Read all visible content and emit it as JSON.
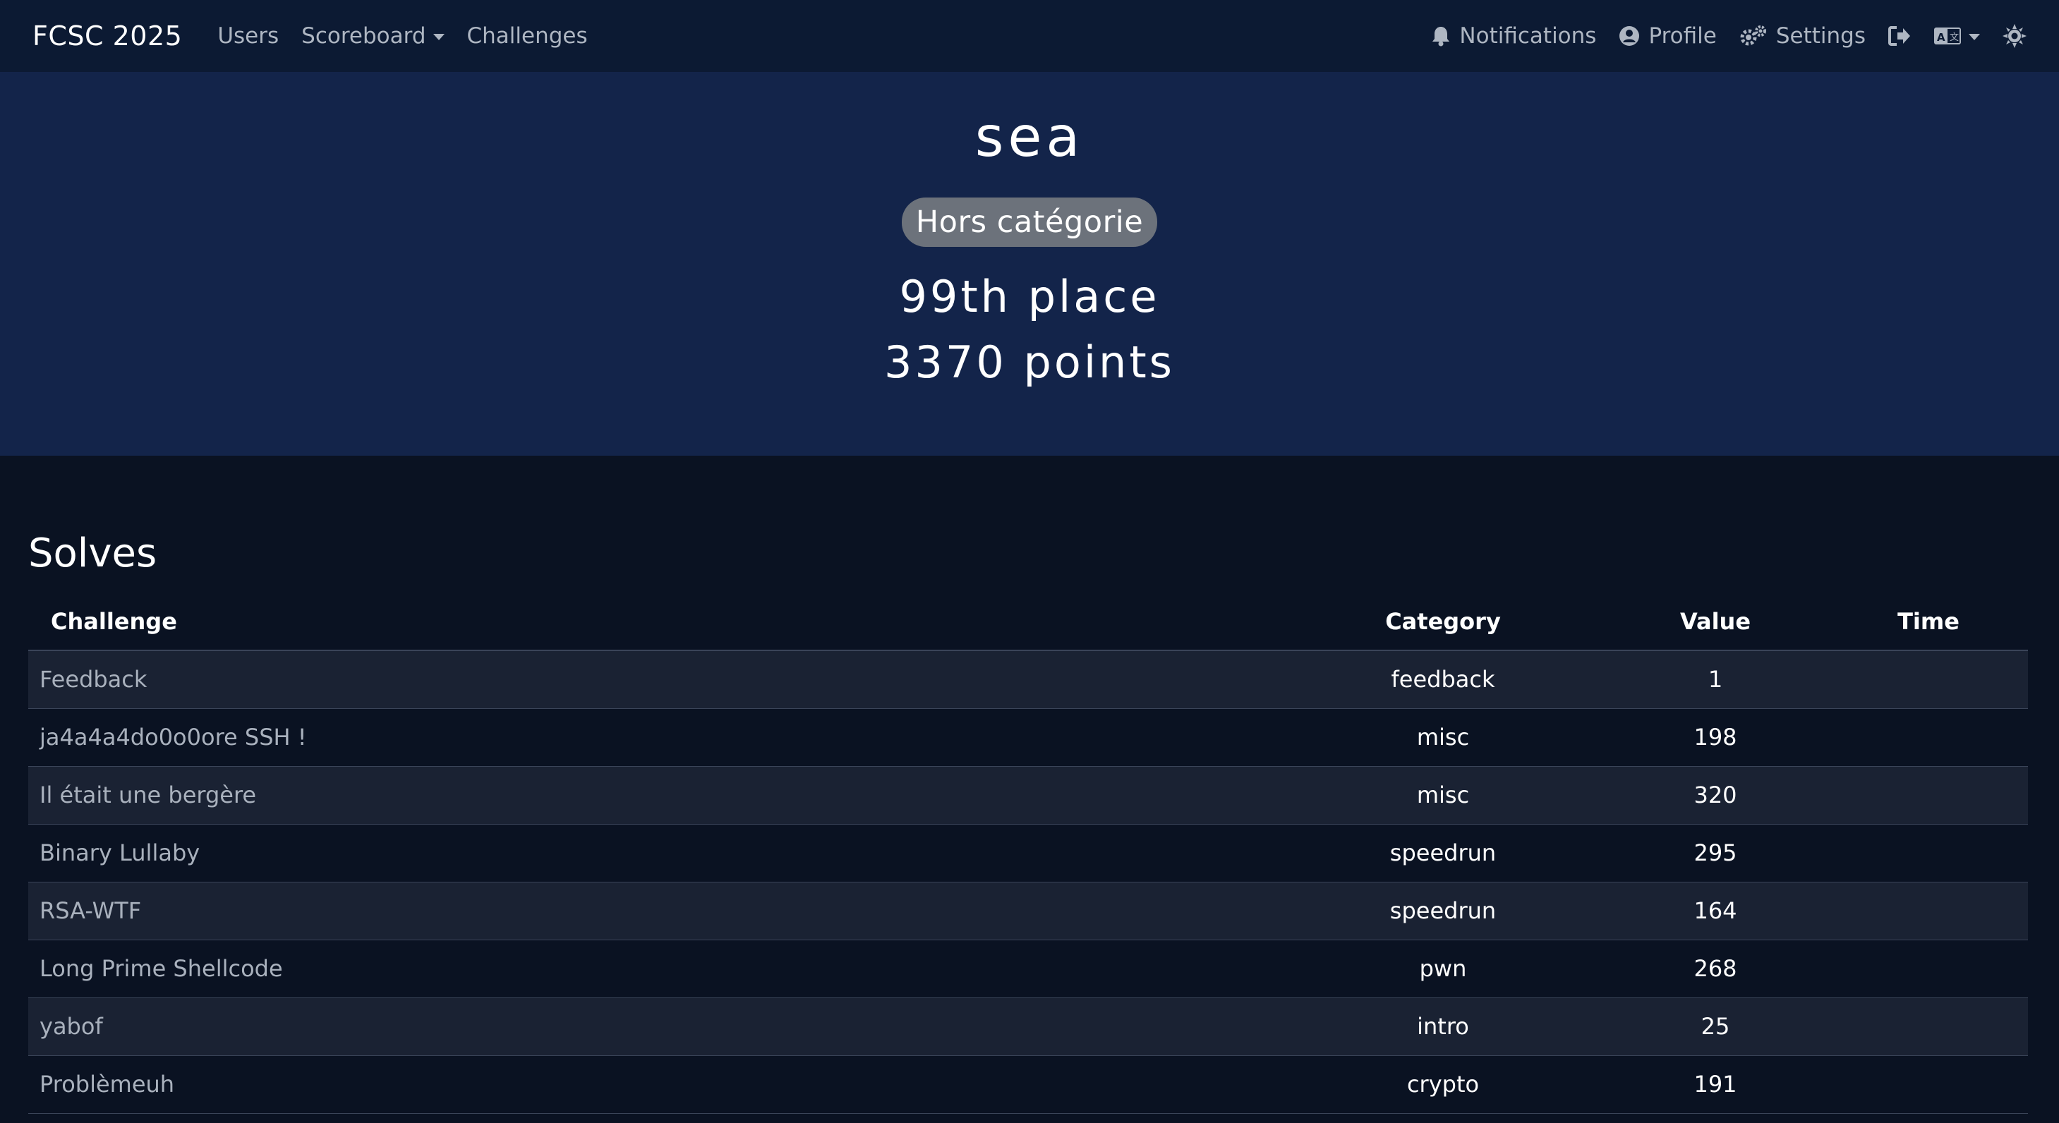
{
  "nav": {
    "brand": "FCSC 2025",
    "users": "Users",
    "scoreboard": "Scoreboard",
    "challenges": "Challenges",
    "notifications": "Notifications",
    "profile": "Profile",
    "settings": "Settings"
  },
  "user": {
    "name": "sea",
    "badge": "Hors catégorie",
    "place": "99th place",
    "points": "3370 points"
  },
  "solves": {
    "title": "Solves",
    "headers": {
      "challenge": "Challenge",
      "category": "Category",
      "value": "Value",
      "time": "Time"
    },
    "rows": [
      {
        "challenge": "Feedback",
        "category": "feedback",
        "value": "1",
        "time": ""
      },
      {
        "challenge": "ja4a4a4do0o0ore SSH !",
        "category": "misc",
        "value": "198",
        "time": ""
      },
      {
        "challenge": "Il était une bergère",
        "category": "misc",
        "value": "320",
        "time": ""
      },
      {
        "challenge": "Binary Lullaby",
        "category": "speedrun",
        "value": "295",
        "time": ""
      },
      {
        "challenge": "RSA-WTF",
        "category": "speedrun",
        "value": "164",
        "time": ""
      },
      {
        "challenge": "Long Prime Shellcode",
        "category": "pwn",
        "value": "268",
        "time": ""
      },
      {
        "challenge": "yabof",
        "category": "intro",
        "value": "25",
        "time": ""
      },
      {
        "challenge": "Problèmeuh",
        "category": "crypto",
        "value": "191",
        "time": ""
      }
    ]
  },
  "colors": {
    "navbar": "#0c1a33",
    "hero": "#13244a",
    "page": "#0a1222",
    "badge": "#6c727b",
    "striped_row": "#1a2233"
  },
  "icons": [
    "bell-icon",
    "user-circle-icon",
    "gears-icon",
    "logout-icon",
    "language-icon",
    "theme-toggle-icon"
  ]
}
